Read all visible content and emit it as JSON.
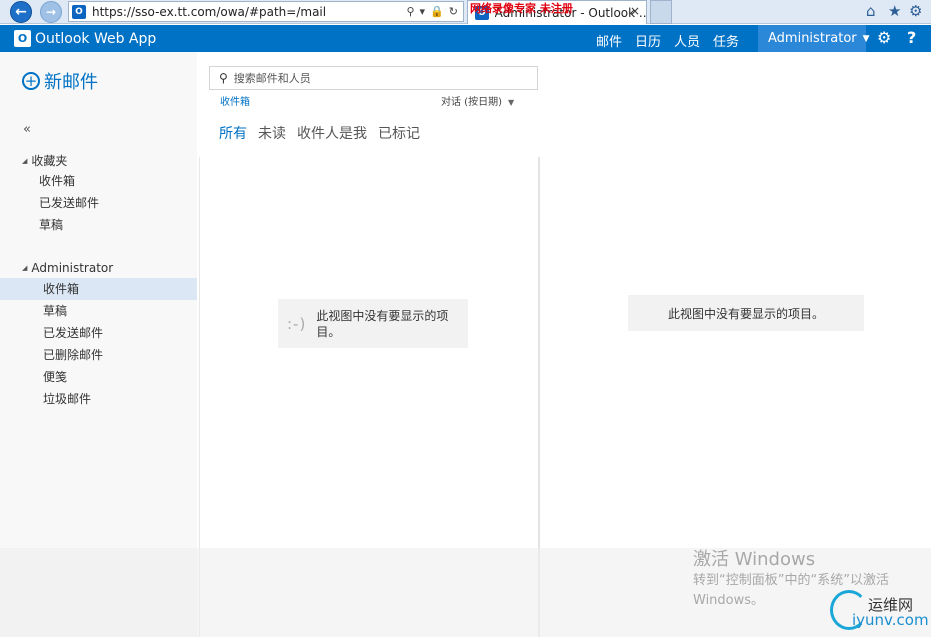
{
  "browser": {
    "url": "https://sso-ex.tt.com/owa/#path=/mail",
    "tab_title": "Administrator - Outlook ...",
    "overlay_text": "网络录像专家 未注册",
    "favicon_label": "O"
  },
  "app": {
    "name": "Outlook Web App",
    "nav": [
      "邮件",
      "日历",
      "人员",
      "任务"
    ],
    "active_nav": "邮件",
    "user": "Administrator"
  },
  "left": {
    "new_mail": "新邮件",
    "collapse": "«",
    "favorites_label": "收藏夹",
    "favorites": [
      "收件箱",
      "已发送邮件",
      "草稿"
    ],
    "account_label": "Administrator",
    "folders": [
      "收件箱",
      "草稿",
      "已发送邮件",
      "已删除邮件",
      "便笺",
      "垃圾邮件"
    ],
    "selected_folder": "收件箱"
  },
  "middle": {
    "search_placeholder": "搜索邮件和人员",
    "folder_label": "收件箱",
    "sort_label": "对话 (按日期)",
    "filters": [
      "所有",
      "未读",
      "收件人是我",
      "已标记"
    ],
    "active_filter": "所有",
    "empty_face": ":-)",
    "empty_message": "此视图中没有要显示的项目。"
  },
  "reading": {
    "empty_message": "此视图中没有要显示的项目。"
  },
  "overlay": {
    "activate_title": "激活 Windows",
    "activate_line2": "转到“控制面板”中的“系统”以激活",
    "activate_line3": "Windows。",
    "site_name_cn": "运维网",
    "site_name_en": "iyunv.com"
  },
  "colors": {
    "brand_blue": "#0072c6",
    "user_box": "#2b88d8",
    "selected_row": "#dbe7f4"
  }
}
